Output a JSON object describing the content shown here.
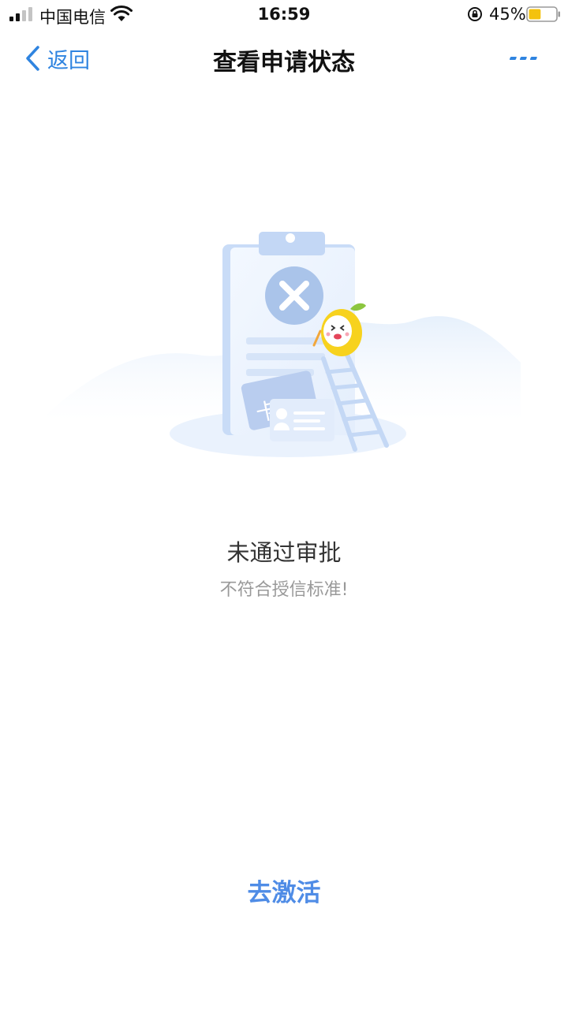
{
  "status_bar": {
    "carrier": "中国电信",
    "time": "16:59",
    "battery_percent": "45%",
    "battery_level": 0.45,
    "icons": [
      "cellular-signal-icon",
      "wifi-icon",
      "orientation-lock-icon",
      "battery-icon"
    ]
  },
  "nav": {
    "back_label": "返回",
    "title": "查看申请状态",
    "more_icon": "more-dots-icon",
    "accent_color": "#2f84e0"
  },
  "illustration": {
    "icon": "rejected-application-illustration"
  },
  "result": {
    "title": "未通过审批",
    "description": "不符合授信标准!"
  },
  "action": {
    "label": "去激活",
    "color": "#4f8ce6"
  }
}
